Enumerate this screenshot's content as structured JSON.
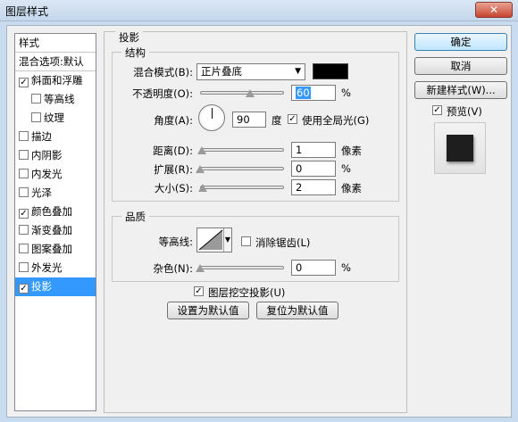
{
  "window": {
    "title": "图层样式",
    "close_label": "✕"
  },
  "sidebar": {
    "items": [
      {
        "label": "样式",
        "checkbox": false,
        "checked": false,
        "selected": false
      },
      {
        "label": "混合选项:默认",
        "checkbox": false,
        "checked": false,
        "selected": false
      },
      {
        "label": "斜面和浮雕",
        "checkbox": true,
        "checked": true,
        "selected": false
      },
      {
        "label": "等高线",
        "checkbox": true,
        "checked": false,
        "selected": false
      },
      {
        "label": "纹理",
        "checkbox": true,
        "checked": false,
        "selected": false
      },
      {
        "label": "描边",
        "checkbox": true,
        "checked": false,
        "selected": false
      },
      {
        "label": "内阴影",
        "checkbox": true,
        "checked": false,
        "selected": false
      },
      {
        "label": "内发光",
        "checkbox": true,
        "checked": false,
        "selected": false
      },
      {
        "label": "光泽",
        "checkbox": true,
        "checked": false,
        "selected": false
      },
      {
        "label": "颜色叠加",
        "checkbox": true,
        "checked": true,
        "selected": false
      },
      {
        "label": "渐变叠加",
        "checkbox": true,
        "checked": false,
        "selected": false
      },
      {
        "label": "图案叠加",
        "checkbox": true,
        "checked": false,
        "selected": false
      },
      {
        "label": "外发光",
        "checkbox": true,
        "checked": false,
        "selected": false
      },
      {
        "label": "投影",
        "checkbox": true,
        "checked": true,
        "selected": true
      }
    ]
  },
  "panel": {
    "title": "投影",
    "structure": {
      "title": "结构",
      "blend_mode_label": "混合模式(B):",
      "blend_mode_value": "正片叠底",
      "shadow_color": "#000000",
      "opacity_label": "不透明度(O):",
      "opacity_value": "60",
      "opacity_unit": "%",
      "opacity_fraction": 0.6,
      "angle_label": "角度(A):",
      "angle_value": "90",
      "angle_unit": "度",
      "global_light_label": "使用全局光(G)",
      "global_light_checked": true,
      "distance_label": "距离(D):",
      "distance_value": "1",
      "distance_unit": "像素",
      "spread_label": "扩展(R):",
      "spread_value": "0",
      "spread_unit": "%",
      "size_label": "大小(S):",
      "size_value": "2",
      "size_unit": "像素"
    },
    "quality": {
      "title": "品质",
      "contour_label": "等高线:",
      "antialias_label": "消除锯齿(L)",
      "antialias_checked": false,
      "noise_label": "杂色(N):",
      "noise_value": "0",
      "noise_unit": "%"
    },
    "knockout_label": "图层挖空投影(U)",
    "knockout_checked": true,
    "make_default_label": "设置为默认值",
    "reset_default_label": "复位为默认值"
  },
  "buttons": {
    "ok": "确定",
    "cancel": "取消",
    "new_style": "新建样式(W)...",
    "preview_label": "预览(V)",
    "preview_checked": true
  }
}
